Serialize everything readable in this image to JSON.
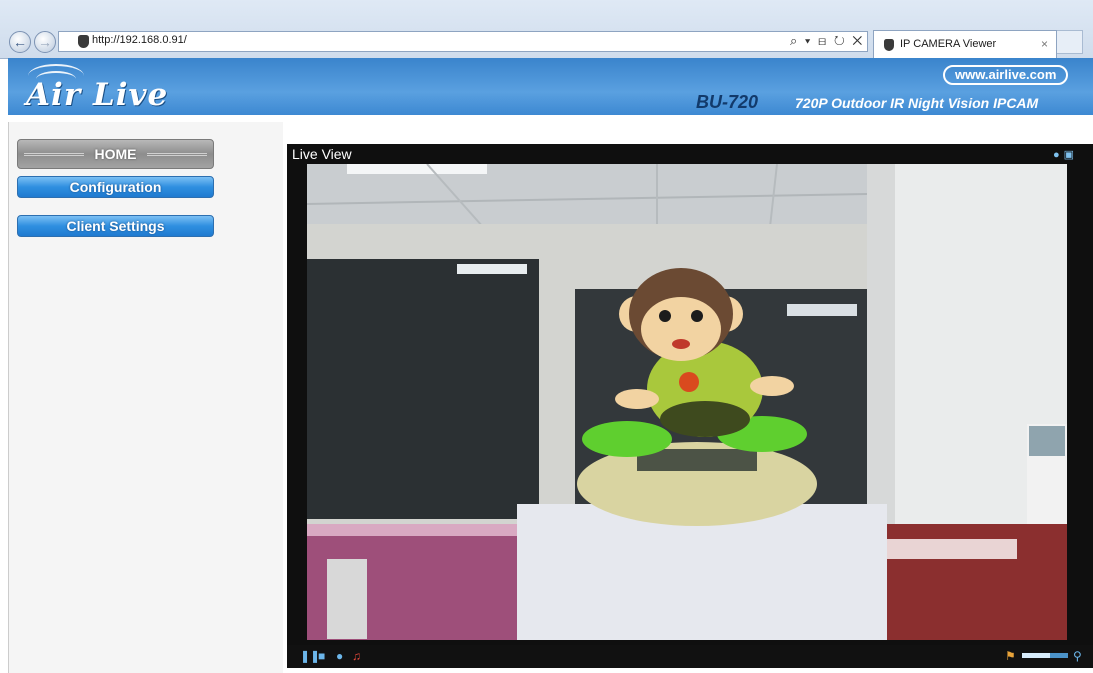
{
  "browser": {
    "url": "http://192.168.0.91/",
    "tab_title": "IP CAMERA Viewer",
    "tab_close": "×",
    "address_tools": "⌕ ▾ ⊟ ↻ ✕",
    "back_icon": "back-icon",
    "forward_icon": "forward-icon"
  },
  "header": {
    "logo_text": "Air Live",
    "website": "www.airlive.com",
    "model": "BU-720",
    "description": "720P Outdoor IR Night Vision IPCAM",
    "colors": {
      "banner": "#4a95da",
      "model_text": "#123a6b"
    }
  },
  "menu": {
    "home": "HOME",
    "configuration": "Configuration",
    "client_settings": "Client Settings"
  },
  "live_view": {
    "title": "Live View",
    "top_icons": [
      "camera-snapshot-icon",
      "fullscreen-icon"
    ],
    "controls": [
      "pause-icon",
      "stop-icon",
      "record-icon",
      "mute-icon"
    ],
    "zoom_level": 0.6,
    "zoom_icon": "zoom-icon",
    "video_content": "live camera feed: office with monkey toy on box"
  }
}
